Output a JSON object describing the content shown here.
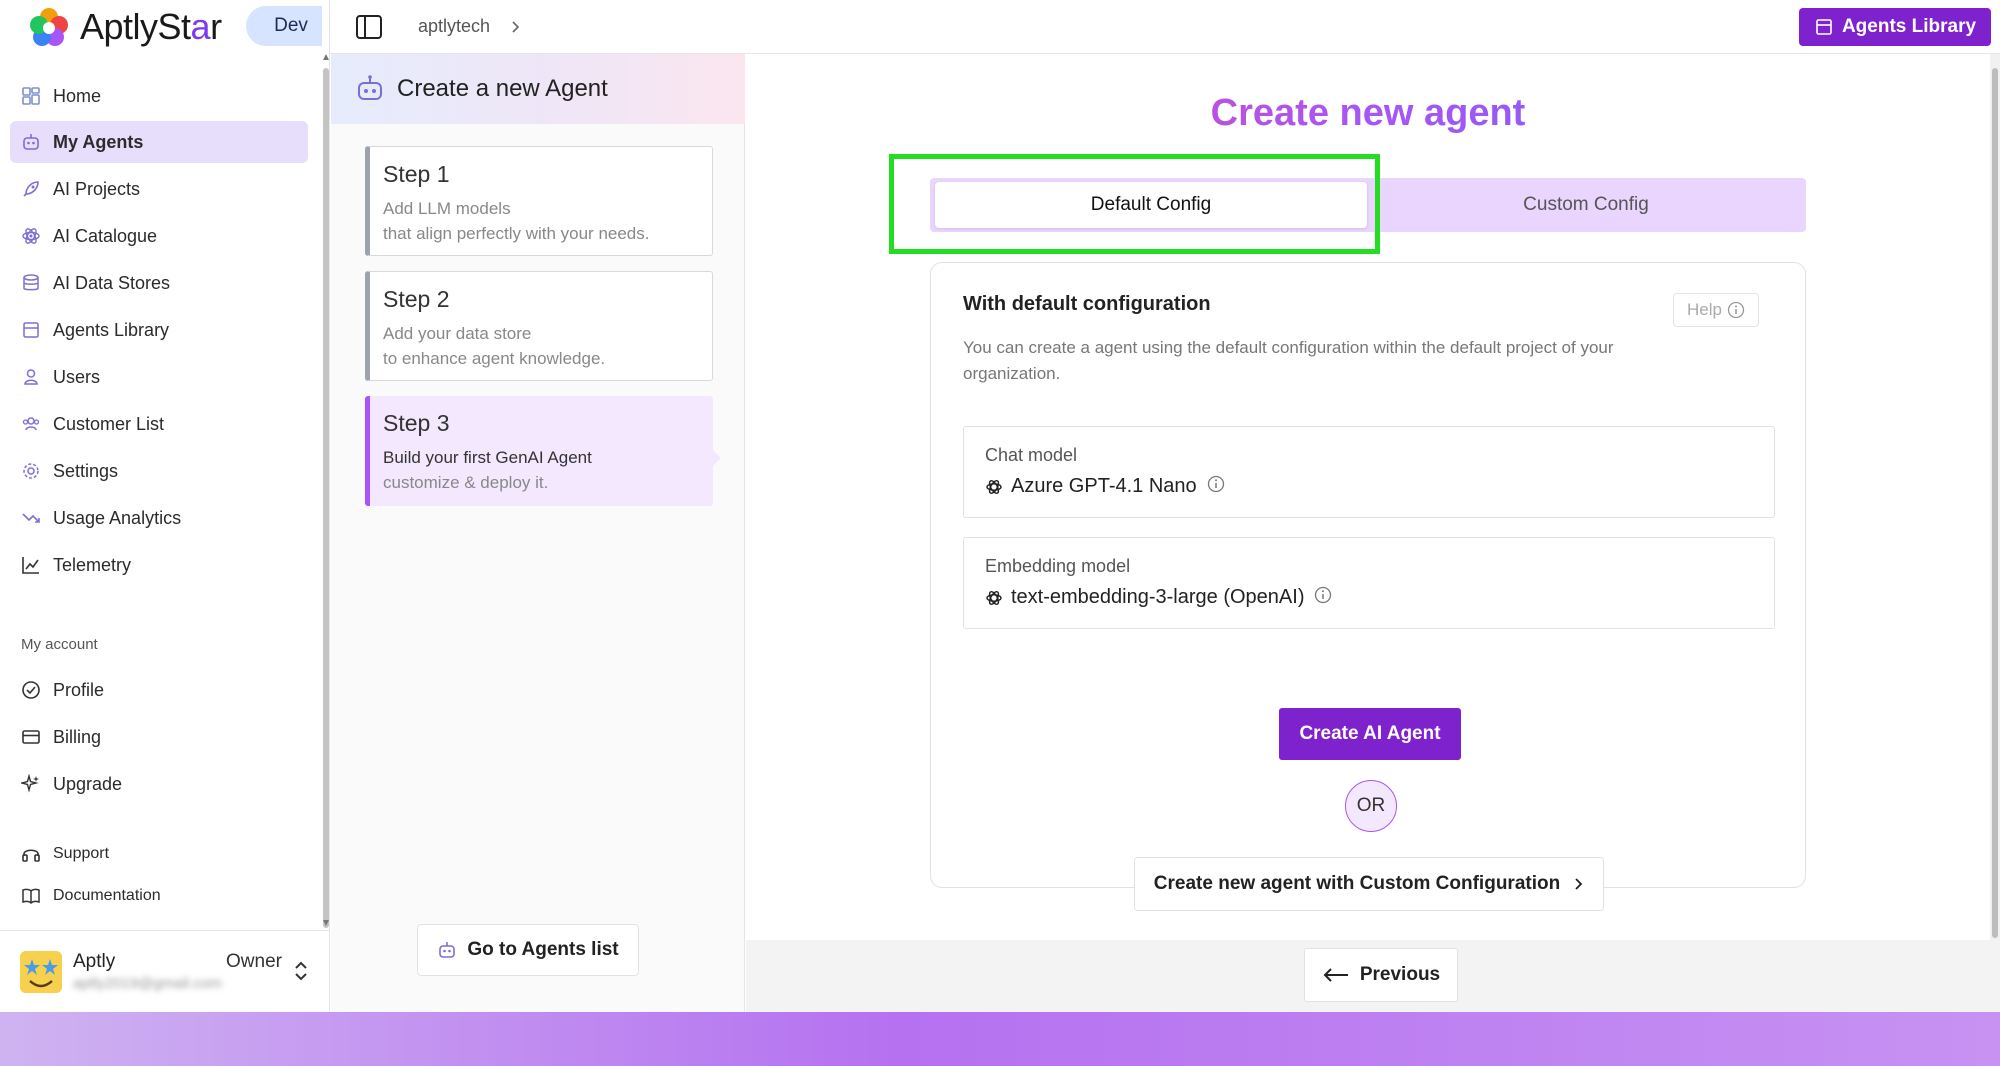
{
  "app": {
    "brand_prefix": "AptlySt",
    "brand_star": "a",
    "brand_suffix": "r",
    "environment": "Dev"
  },
  "colors": {
    "accent": "#7e22ce",
    "active_nav_bg": "#e7defc",
    "tab_bg": "#e9d5fd",
    "highlight": "#22dd22"
  },
  "sidebar": {
    "items": [
      {
        "label": "Home",
        "icon": "home-icon"
      },
      {
        "label": "My Agents",
        "icon": "robot-icon",
        "active": true
      },
      {
        "label": "AI Projects",
        "icon": "rocket-icon"
      },
      {
        "label": "AI Catalogue",
        "icon": "atom-icon"
      },
      {
        "label": "AI Data Stores",
        "icon": "database-icon"
      },
      {
        "label": "Agents Library",
        "icon": "library-icon"
      },
      {
        "label": "Users",
        "icon": "user-icon"
      },
      {
        "label": "Customer List",
        "icon": "customers-icon"
      },
      {
        "label": "Settings",
        "icon": "gear-icon"
      },
      {
        "label": "Usage Analytics",
        "icon": "trend-icon"
      },
      {
        "label": "Telemetry",
        "icon": "chart-line-icon"
      }
    ],
    "account_heading": "My account",
    "account_items": [
      {
        "label": "Profile",
        "icon": "check-circle-icon"
      },
      {
        "label": "Billing",
        "icon": "credit-card-icon"
      },
      {
        "label": "Upgrade",
        "icon": "sparkles-icon"
      }
    ],
    "support_items": [
      {
        "label": "Support",
        "icon": "headset-icon"
      },
      {
        "label": "Documentation",
        "icon": "book-icon"
      }
    ],
    "user": {
      "name": "Aptly",
      "email": "aptly2019@gmail.com",
      "role": "Owner"
    }
  },
  "topbar": {
    "breadcrumb": "aptlytech",
    "agents_library_label": "Agents Library"
  },
  "steps_panel": {
    "title": "Create a new Agent",
    "steps": [
      {
        "title": "Step 1",
        "line1": "Add LLM models",
        "line2": "that align perfectly with your needs."
      },
      {
        "title": "Step 2",
        "line1": "Add your data store",
        "line2": "to enhance agent knowledge."
      },
      {
        "title": "Step 3",
        "line1": "Build your first GenAI Agent",
        "line2": "customize & deploy it.",
        "active": true
      }
    ],
    "go_to_agents_label": "Go to Agents list"
  },
  "main": {
    "title": "Create new agent",
    "tabs": [
      {
        "label": "Default Config",
        "selected": true
      },
      {
        "label": "Custom Config"
      }
    ],
    "card": {
      "title": "With default configuration",
      "help_label": "Help",
      "description": "You can create a agent using the default configuration within the default project of your organization.",
      "chat_model_label": "Chat model",
      "chat_model_value": "Azure GPT-4.1 Nano",
      "embedding_model_label": "Embedding model",
      "embedding_model_value": "text-embedding-3-large (OpenAI)",
      "create_label": "Create AI Agent",
      "or_label": "OR",
      "custom_label": "Create new agent with Custom Configuration"
    },
    "previous_label": "Previous"
  }
}
